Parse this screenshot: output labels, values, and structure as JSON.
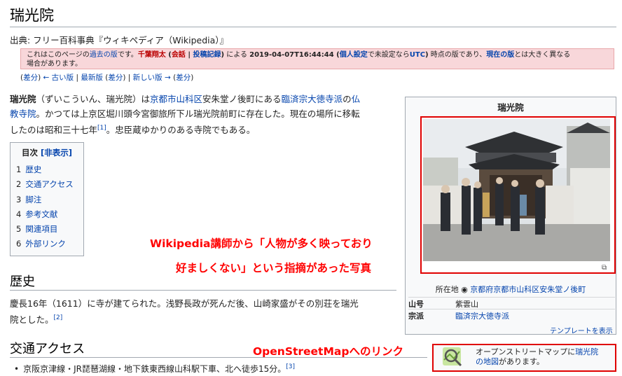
{
  "page_title": "瑞光院",
  "source_line": "出典: フリー百科事典『ウィキペディア（Wikipedia）』",
  "old_revision": {
    "prefix": "これはこのページの",
    "past_version": "過去の版",
    "is": "です。",
    "user": "千葉翔太",
    "open_paren": " (",
    "talk": "会話",
    "sep": " | ",
    "contribs": "投稿記録",
    "close_paren": ")",
    "by": " による ",
    "timestamp": "2019-04-07T16:44:44",
    "paren_open": " (",
    "settings": "個人設定",
    "unset": "で未設定なら",
    "utc": "UTC",
    "paren_close": ")",
    "middle": " 時点の版であり、",
    "current": "現在の版",
    "suffix_line1": "とは大きく異なる",
    "line2": "場合があります。"
  },
  "revision_nav": {
    "diff1": "差分",
    "older": "← 古い版",
    "latest": "最新版",
    "diff2": "差分",
    "newer": "新しい版 →",
    "diff3": "差分"
  },
  "intro": {
    "name": "瑞光院",
    "reading": "（ずいこういん、瑞光院）は",
    "link_place": "京都市山科区",
    "place_rest": "安朱堂ノ後町にある",
    "link_school": "臨済宗大徳寺派",
    "no": "の",
    "link_temple_1": "仏",
    "link_temple_2": "教寺院",
    "sentence2": "。かつては上京区堀川頭今宮御旅所下ル瑞光院前町に存在した。現在の場所に移転",
    "sentence3": "したのは昭和三十七年",
    "ref1": "[1]",
    "sentence4": "。忠臣蔵ゆかりのある寺院でもある。"
  },
  "toc": {
    "title": "目次",
    "toggle": "[非表示]",
    "items": [
      {
        "num": "1",
        "label": "歴史"
      },
      {
        "num": "2",
        "label": "交通アクセス"
      },
      {
        "num": "3",
        "label": "脚注"
      },
      {
        "num": "4",
        "label": "参考文献"
      },
      {
        "num": "5",
        "label": "関連項目"
      },
      {
        "num": "6",
        "label": "外部リンク"
      }
    ]
  },
  "history": {
    "heading": "歴史",
    "text1": "慶長16年（1611）に寺が建てられた。浅野長政が死んだ後、山崎家盛がその別荘を瑞光",
    "text2": "院とした。",
    "ref": "[2]"
  },
  "access": {
    "heading": "交通アクセス",
    "bullet": "京阪京津線・JR琵琶湖線・地下鉄東西線山科駅下車、北へ徒歩15分。",
    "ref": "[3]"
  },
  "infobox": {
    "title": "瑞光院",
    "location_label": "所在地",
    "location_value": "京都府京都市山科区安朱堂ノ後町",
    "rows": [
      {
        "key": "山号",
        "value": "紫雲山"
      },
      {
        "key": "宗派",
        "value": "臨済宗大徳寺派"
      }
    ],
    "template_link": "テンプレートを表示"
  },
  "annotations": {
    "photo_note_1": "Wikipedia講師から「人物が多く映っており",
    "photo_note_2": "好ましくない」という指摘があった写真",
    "osm_note": "OpenStreetMapへのリンク"
  },
  "osm_box": {
    "text1": "オープンストリートマップに",
    "link1": "瑞光院",
    "link2": "の地図",
    "text2": "があります。"
  },
  "colors": {
    "link": "#0645ad",
    "annotation_red": "#ff0000",
    "old_revision_bg": "#f8d7da"
  }
}
